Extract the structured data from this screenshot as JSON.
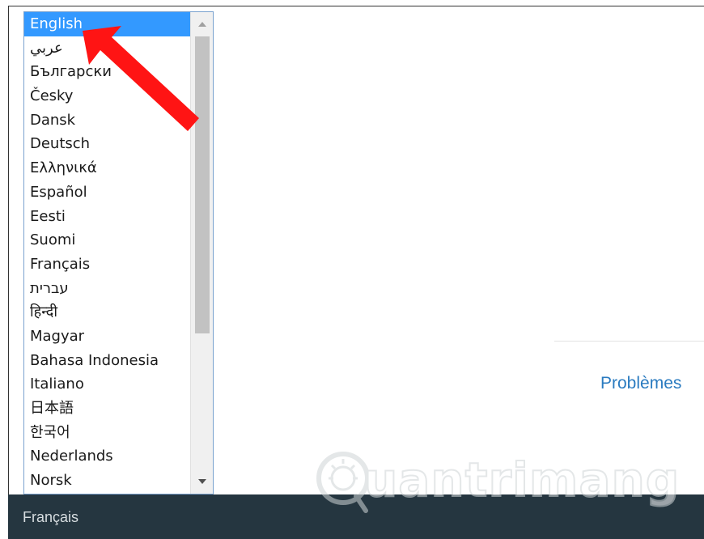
{
  "language_list": {
    "items": [
      {
        "label": "English",
        "selected": true
      },
      {
        "label": "عربي"
      },
      {
        "label": "Български"
      },
      {
        "label": "Česky"
      },
      {
        "label": "Dansk"
      },
      {
        "label": "Deutsch"
      },
      {
        "label": "Ελληνικά"
      },
      {
        "label": "Español"
      },
      {
        "label": "Eesti"
      },
      {
        "label": "Suomi"
      },
      {
        "label": "Français"
      },
      {
        "label": "עברית"
      },
      {
        "label": "हिन्दी"
      },
      {
        "label": "Magyar"
      },
      {
        "label": "Bahasa Indonesia"
      },
      {
        "label": "Italiano"
      },
      {
        "label": "日本語"
      },
      {
        "label": "한국어"
      },
      {
        "label": "Nederlands"
      },
      {
        "label": "Norsk"
      }
    ],
    "scroll_up_icon": "triangle-up",
    "scroll_down_icon": "triangle-down"
  },
  "main": {
    "problems_link": "Problèmes"
  },
  "footer": {
    "current_language": "Français"
  },
  "annotation": {
    "arrow_color": "#ff0000"
  },
  "watermark": {
    "text": "uantrimang"
  },
  "colors": {
    "selected_bg": "#3399ff",
    "footer_bg": "#253640",
    "link": "#2a7bc0"
  }
}
